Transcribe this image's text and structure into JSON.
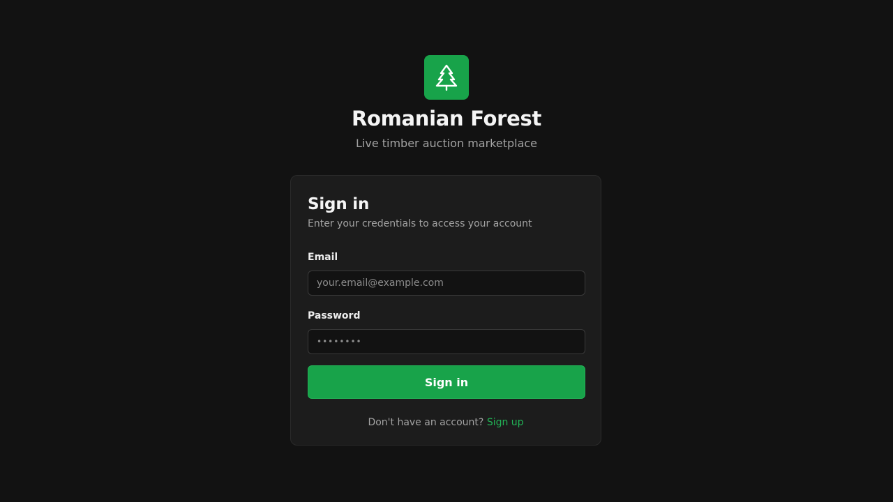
{
  "brand": {
    "logo_icon": "tree-icon",
    "accent_color": "#18a34a",
    "title": "Romanian Forest",
    "subtitle": "Live timber auction marketplace"
  },
  "form": {
    "title": "Sign in",
    "description": "Enter your credentials to access your account",
    "email": {
      "label": "Email",
      "placeholder": "your.email@example.com",
      "value": ""
    },
    "password": {
      "label": "Password",
      "placeholder": "••••••••",
      "value": ""
    },
    "submit_label": "Sign in",
    "footer_text": "Don't have an account?",
    "signup_label": "Sign up"
  }
}
